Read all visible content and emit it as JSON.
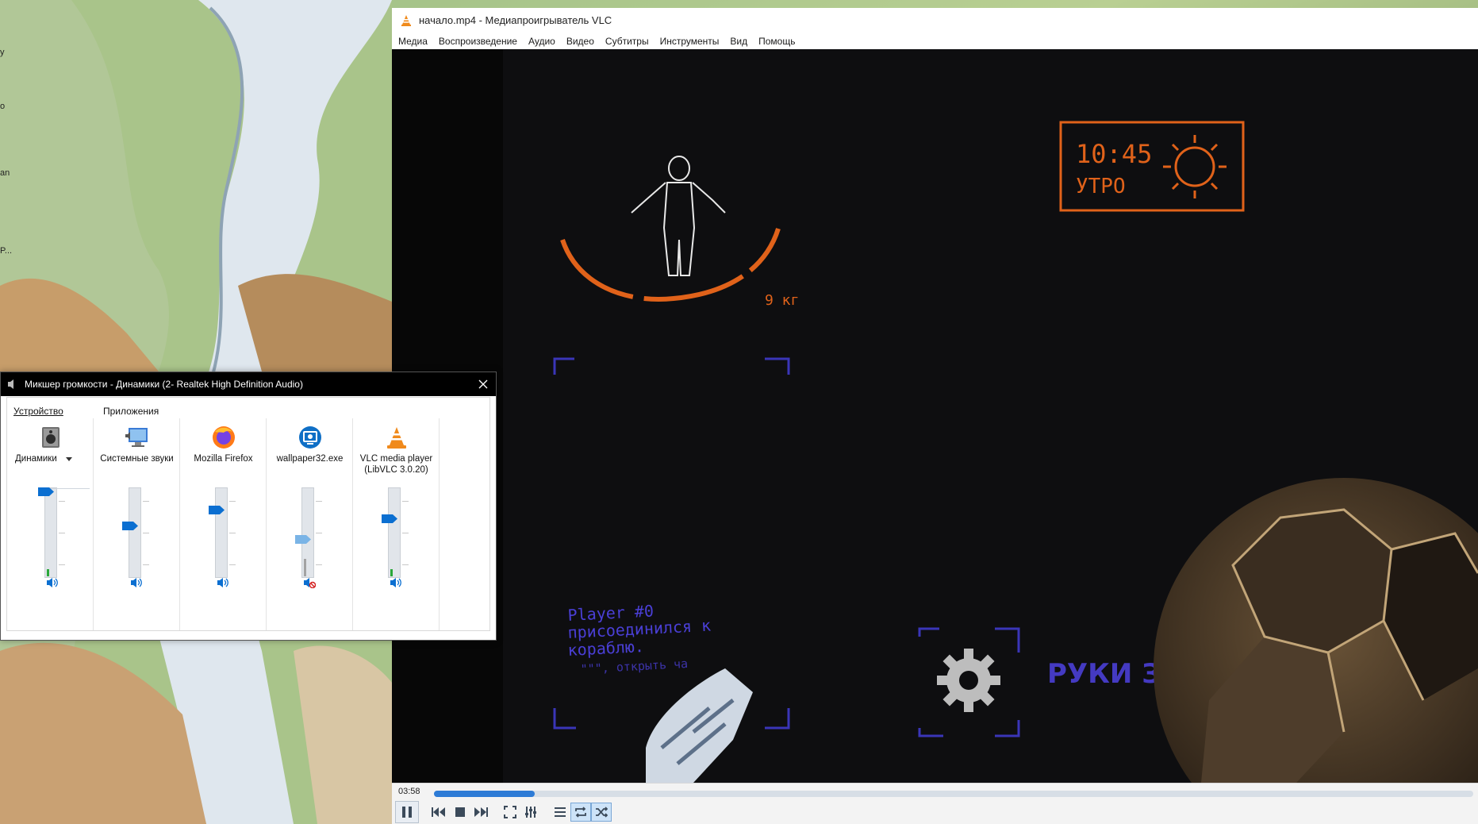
{
  "desktop": {
    "labels": [
      "y",
      "o",
      "an",
      "P..."
    ]
  },
  "vlc": {
    "title": "начало.mp4 - Медиапроигрыватель VLC",
    "menu": [
      "Медиа",
      "Воспроизведение",
      "Аудио",
      "Видео",
      "Субтитры",
      "Инструменты",
      "Вид",
      "Помощь"
    ],
    "time_elapsed": "03:58",
    "progress": 0.097,
    "colors": {
      "accent": "#2d7bd6",
      "hud_orange": "#e0621a",
      "hud_blue": "#4a3fd6"
    },
    "controls": {
      "pause_icon": "pause-icon",
      "prev_icon": "previous-icon",
      "stop_icon": "stop-icon",
      "next_icon": "next-icon",
      "fullscreen_icon": "fullscreen-icon",
      "extended_icon": "equalizer-icon",
      "playlist_icon": "playlist-icon",
      "loop_icon": "loop-icon",
      "shuffle_icon": "shuffle-icon"
    },
    "video": {
      "clock_time": "10:45",
      "clock_period": "УТРО",
      "weight": "9 кг",
      "chat_line1": "Player #0",
      "chat_line2": "присоединился к",
      "chat_line3": "кораблю.",
      "chat_hint": "\"\"\", открыть ча",
      "hands_status": "РУКИ ЗАНЯТЫ"
    }
  },
  "mixer": {
    "title": "Микшер громкости - Динамики (2- Realtek High Definition Audio)",
    "device_group": "Устройство",
    "apps_group": "Приложения",
    "device": {
      "name": "Динамики",
      "level": 1.0,
      "peak": 0.08,
      "muted": false
    },
    "apps": [
      {
        "name": "Системные звуки",
        "level": 0.58,
        "peak": 0.0,
        "muted": false,
        "icon": "system-sounds-icon"
      },
      {
        "name": "Mozilla Firefox",
        "level": 0.78,
        "peak": 0.0,
        "muted": false,
        "icon": "firefox-icon"
      },
      {
        "name": "wallpaper32.exe",
        "level": 0.42,
        "peak": 0.2,
        "muted": true,
        "icon": "wallpaper-engine-icon"
      },
      {
        "name": "VLC media player (LibVLC 3.0.20)",
        "level": 0.67,
        "peak": 0.08,
        "muted": false,
        "icon": "vlc-icon"
      }
    ]
  }
}
